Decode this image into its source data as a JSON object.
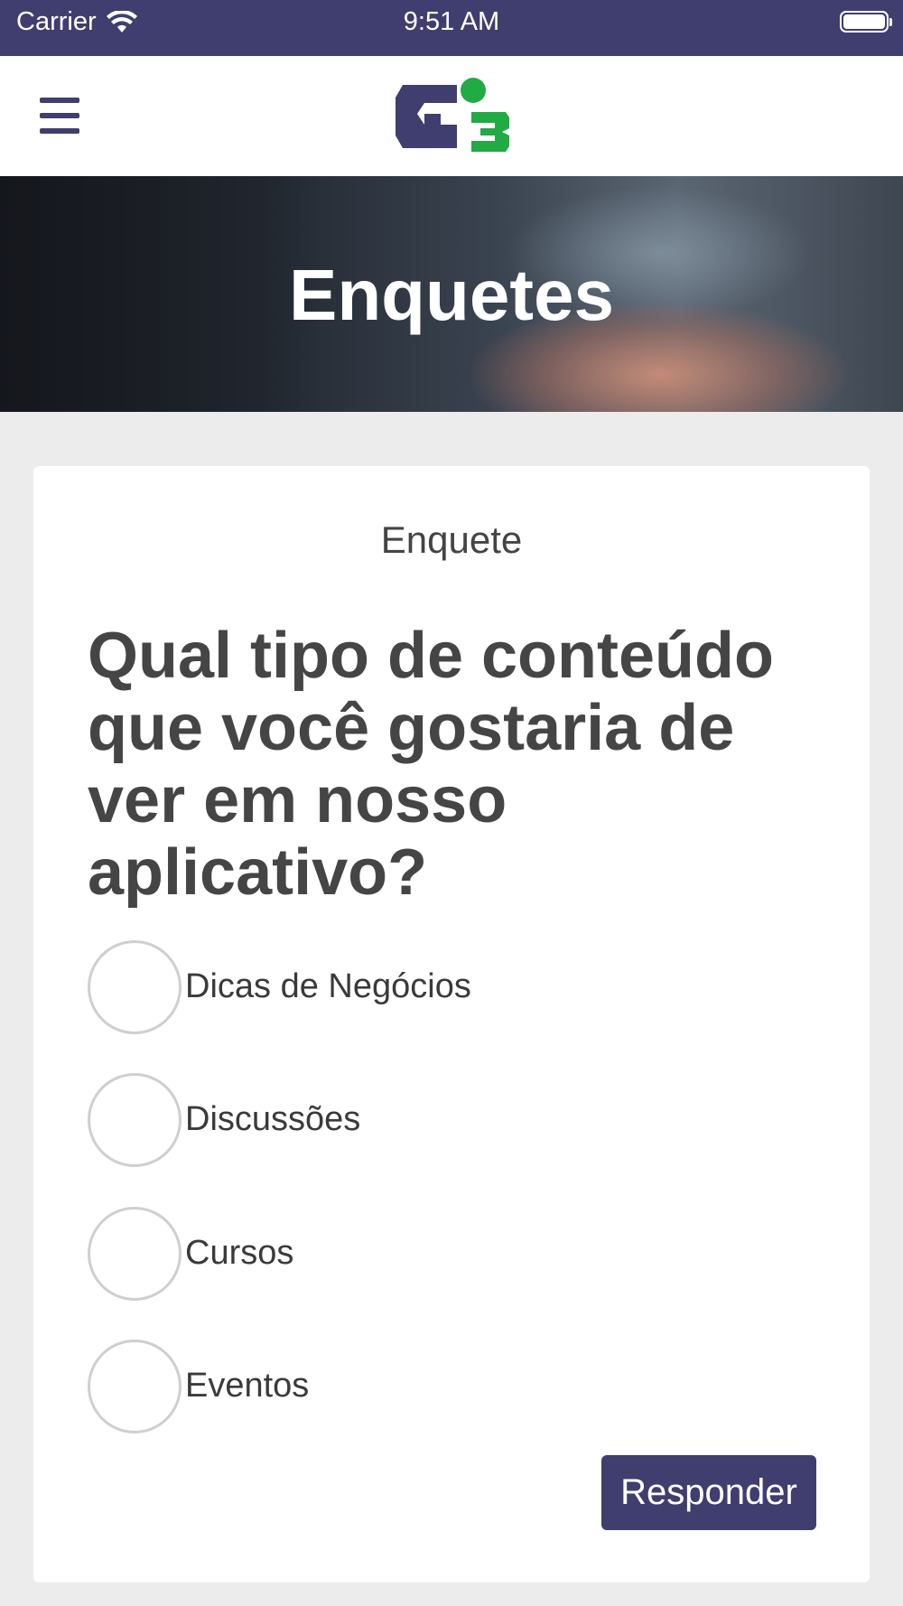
{
  "status_bar": {
    "carrier": "Carrier",
    "time": "9:51 AM",
    "icons": [
      "wifi-icon",
      "battery-icon"
    ]
  },
  "nav": {
    "menu_icon": "hamburger-menu-icon",
    "logo_icon": "gb-logo-icon",
    "colors": {
      "brand_purple": "#403e6e",
      "brand_green": "#22aa44"
    }
  },
  "hero": {
    "title": "Enquetes"
  },
  "poll": {
    "label": "Enquete",
    "question": "Qual tipo de conteúdo que você gostaria de ver em nosso aplicativo?",
    "options": [
      {
        "label": "Dicas de Negócios",
        "selected": false
      },
      {
        "label": "Discussões",
        "selected": false
      },
      {
        "label": "Cursos",
        "selected": false
      },
      {
        "label": "Eventos",
        "selected": false
      }
    ],
    "submit_label": "Responder"
  }
}
